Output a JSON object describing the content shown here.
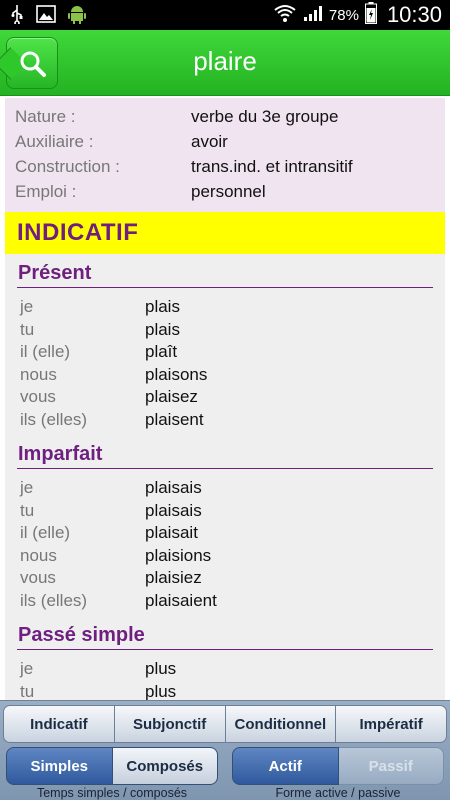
{
  "status_bar": {
    "icons_left": [
      "usb-icon",
      "image-icon",
      "android-icon"
    ],
    "icons_right": [
      "wifi-icon",
      "signal-icon",
      "battery-icon"
    ],
    "battery": "78%",
    "time": "10:30"
  },
  "header": {
    "title": "plaire",
    "search_icon": "search-icon",
    "accent": "#2ec82a"
  },
  "info": {
    "rows": [
      {
        "label": "Nature :",
        "value": "verbe du 3e groupe"
      },
      {
        "label": "Auxiliaire :",
        "value": "avoir"
      },
      {
        "label": "Construction :",
        "value": "trans.ind. et intransitif"
      },
      {
        "label": "Emploi :",
        "value": "personnel"
      }
    ]
  },
  "mode": {
    "title": "INDICATIF",
    "banner_color": "#ffff00",
    "title_color": "#6e1f7f"
  },
  "tenses": [
    {
      "title": "Présent",
      "rows": [
        {
          "pronoun": "je",
          "form": "plais"
        },
        {
          "pronoun": "tu",
          "form": "plais"
        },
        {
          "pronoun": "il (elle)",
          "form": "plaît"
        },
        {
          "pronoun": "nous",
          "form": "plaisons"
        },
        {
          "pronoun": "vous",
          "form": "plaisez"
        },
        {
          "pronoun": "ils (elles)",
          "form": "plaisent"
        }
      ]
    },
    {
      "title": "Imparfait",
      "rows": [
        {
          "pronoun": "je",
          "form": "plaisais"
        },
        {
          "pronoun": "tu",
          "form": "plaisais"
        },
        {
          "pronoun": "il (elle)",
          "form": "plaisait"
        },
        {
          "pronoun": "nous",
          "form": "plaisions"
        },
        {
          "pronoun": "vous",
          "form": "plaisiez"
        },
        {
          "pronoun": "ils (elles)",
          "form": "plaisaient"
        }
      ]
    },
    {
      "title": "Passé simple",
      "rows": [
        {
          "pronoun": "je",
          "form": "plus"
        },
        {
          "pronoun": "tu",
          "form": "plus"
        }
      ]
    }
  ],
  "bottom": {
    "tabs": [
      "Indicatif",
      "Subjonctif",
      "Conditionnel",
      "Impératif"
    ],
    "tense_group": {
      "options": [
        "Simples",
        "Composés"
      ],
      "selected": "Simples",
      "caption": "Temps simples / composés"
    },
    "voice_group": {
      "options": [
        "Actif",
        "Passif"
      ],
      "selected": "Actif",
      "caption": "Forme active / passive"
    }
  }
}
